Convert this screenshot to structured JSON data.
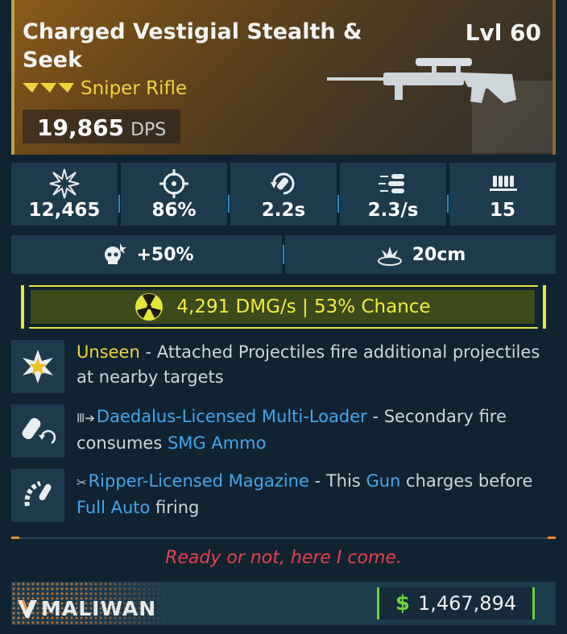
{
  "weapon": {
    "name": "Charged Vestigial Stealth & Seek",
    "level": "Lvl 60",
    "type": "Sniper Rifle",
    "dps_value": "19,865",
    "dps_unit": "DPS"
  },
  "stats": [
    {
      "icon": "damage-icon",
      "value": "12,465"
    },
    {
      "icon": "accuracy-icon",
      "value": "86%"
    },
    {
      "icon": "reload-icon",
      "value": "2.2s"
    },
    {
      "icon": "fire-rate-icon",
      "value": "2.3/s"
    },
    {
      "icon": "magazine-icon",
      "value": "15"
    }
  ],
  "stats2": [
    {
      "icon": "crit-skull-icon",
      "value": "+50%"
    },
    {
      "icon": "splash-icon",
      "value": "20cm"
    }
  ],
  "element": {
    "icon": "radiation-icon",
    "text": "4,291 DMG/s | 53% Chance",
    "color": "#f2ee3a"
  },
  "perks": [
    {
      "icon": "star-burst-icon",
      "name": "Unseen",
      "description": " - Attached Projectiles fire additional projectiles at nearby targets"
    },
    {
      "icon": "multi-loader-icon",
      "mfr_glyph": "Ⅲ➔",
      "name": "Daedalus-Licensed Multi-Loader",
      "desc_part1": " - Secondary fire consumes ",
      "highlight1": "SMG Ammo",
      "desc_part2": ""
    },
    {
      "icon": "magazine-curve-icon",
      "mfr_glyph": "✂",
      "name": "Ripper-Licensed Magazine",
      "desc_part1": " - This ",
      "highlight1": "Gun",
      "desc_part2": " charges before ",
      "highlight2": "Full Auto",
      "desc_part3": " firing"
    }
  ],
  "flavor_text": "Ready or not, here I come.",
  "footer": {
    "manufacturer": "MALIWAN",
    "currency_symbol": "$",
    "price": "1,467,894"
  },
  "colors": {
    "accent_yellow": "#f0d33c",
    "accent_blue": "#43a7ec",
    "price_green": "#6ad23e",
    "flavor_red": "#e8404c",
    "panel": "#1e3b4e"
  }
}
